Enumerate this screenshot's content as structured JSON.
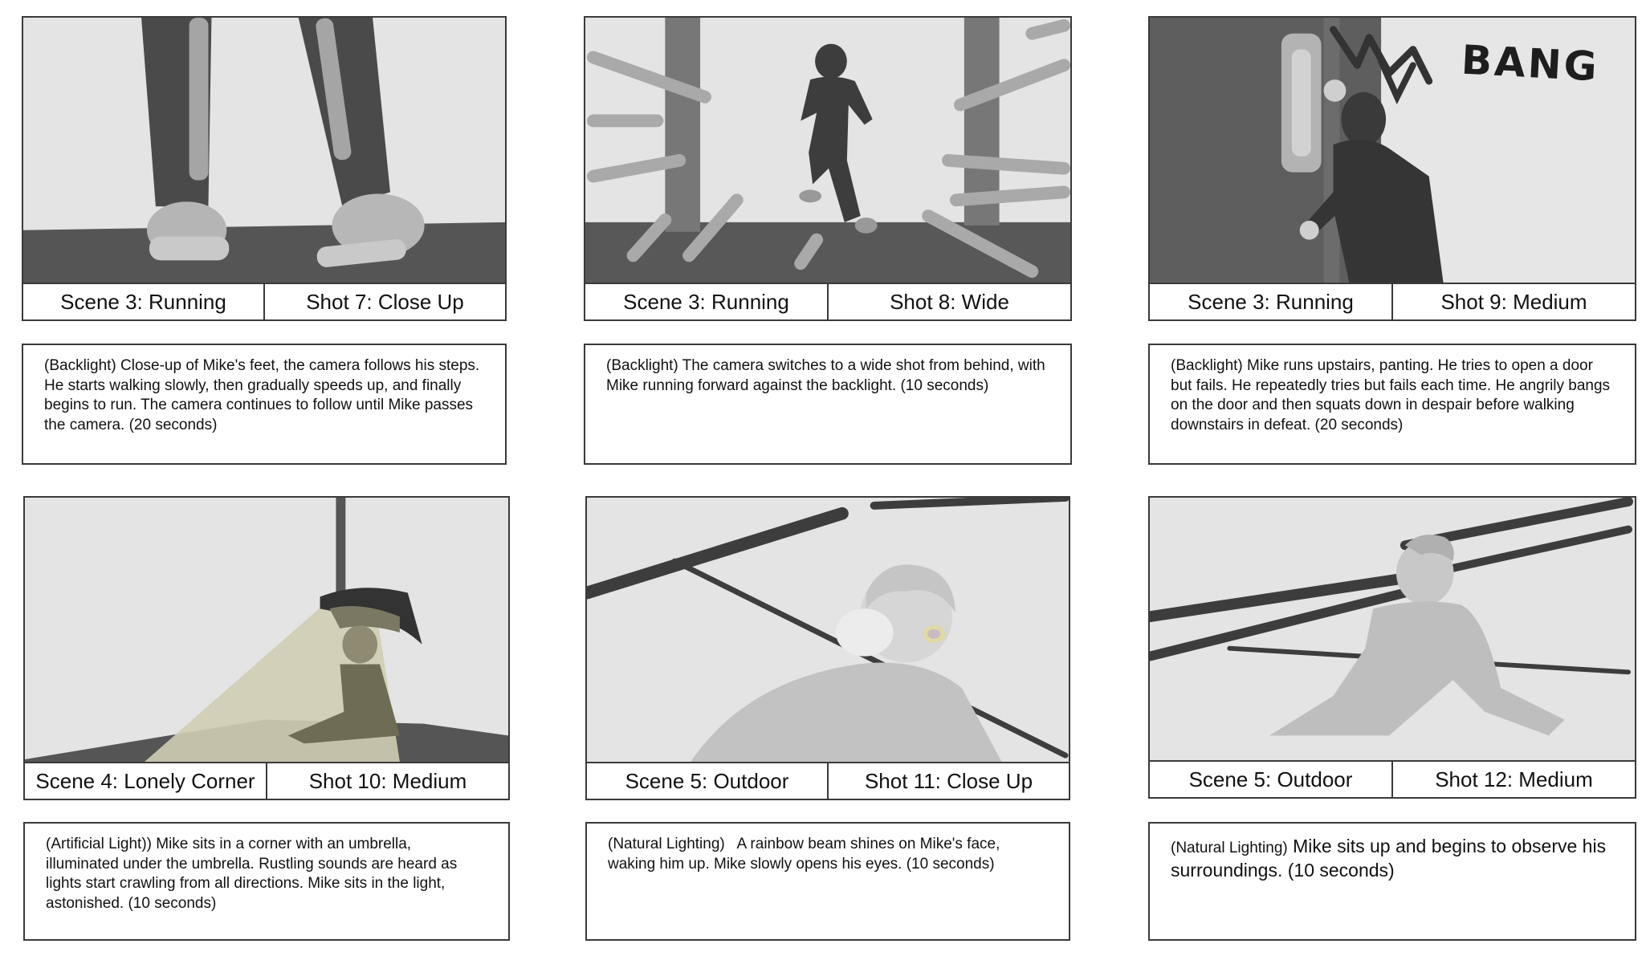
{
  "panels": [
    {
      "scene": "Scene 3: Running",
      "shot": "Shot 7: Close Up",
      "description": "(Backlight) Close-up of Mike's feet, the camera follows his steps. He starts walking slowly, then gradually speeds up, and finally begins to run. The camera continues to follow until Mike passes the camera. (20 seconds)"
    },
    {
      "scene": "Scene 3: Running",
      "shot": "Shot 8: Wide",
      "description": "(Backlight) The camera switches to a wide shot from behind, with Mike running forward against the backlight. (10 seconds)"
    },
    {
      "scene": "Scene 3: Running",
      "shot": "Shot 9: Medium",
      "description": "(Backlight) Mike runs upstairs, panting. He tries to open a door but fails. He repeatedly tries but fails each time. He angrily bangs on the door and then squats down in despair before walking downstairs in defeat. (20 seconds)",
      "sfx_text": "BANG"
    },
    {
      "scene": "Scene 4: Lonely Corner",
      "shot": "Shot 10: Medium",
      "description": "(Artificial Light)) Mike sits in a corner with an umbrella, illuminated under the umbrella. Rustling sounds are heard as lights start crawling from all directions. Mike sits in the light, astonished. (10 seconds)"
    },
    {
      "scene": "Scene 5: Outdoor",
      "shot": "Shot 11: Close Up",
      "description": "(Natural Lighting)   A rainbow beam shines on Mike's face, waking him up. Mike slowly opens his eyes. (10 seconds)"
    },
    {
      "scene": "Scene 5: Outdoor",
      "shot": "Shot 12: Medium",
      "description_prefix": "(Natural Lighting)",
      "description": " Mike sits up and begins to observe his surroundings. (10 seconds)"
    }
  ]
}
